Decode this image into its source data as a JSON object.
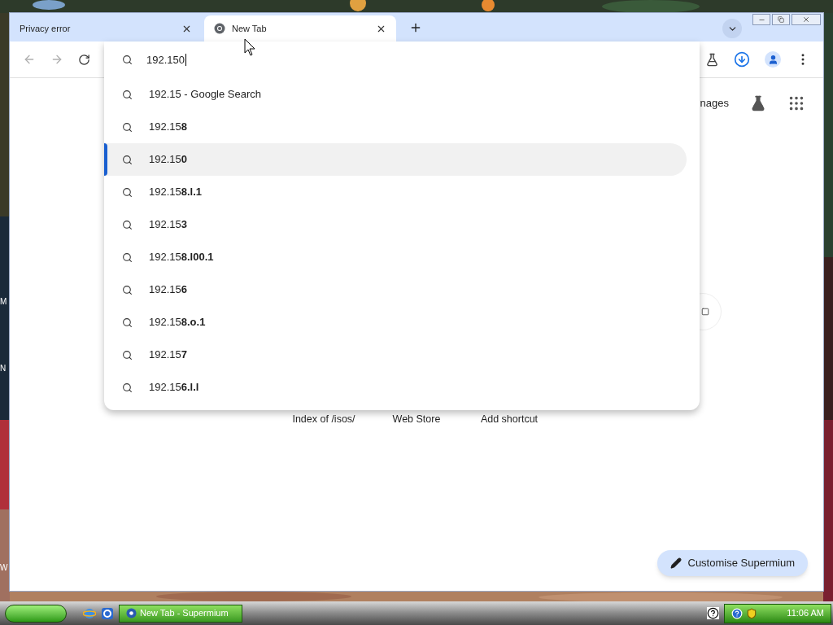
{
  "desktop_labels": [
    "M",
    "N",
    "W"
  ],
  "tabs": [
    {
      "title": "Privacy error",
      "selected": false
    },
    {
      "title": "New Tab",
      "selected": true
    }
  ],
  "omnibox": {
    "value": "192.150"
  },
  "suggestions": [
    {
      "text": "192.15 - Google Search",
      "selected": false
    },
    {
      "text": "192.15**8**",
      "selected": false
    },
    {
      "text": "192.15**0**",
      "selected": true
    },
    {
      "text": "192.15**8.l.1**",
      "selected": false
    },
    {
      "text": "192.15**3**",
      "selected": false
    },
    {
      "text": "192.15**8.l00.1**",
      "selected": false
    },
    {
      "text": "192.15**6**",
      "selected": false
    },
    {
      "text": "192.15**8.o.1**",
      "selected": false
    },
    {
      "text": "192.15**7**",
      "selected": false
    },
    {
      "text": "192.15**6.l.l**",
      "selected": false
    }
  ],
  "page": {
    "header_link": "nages",
    "shortcuts": [
      "Index of /isos/",
      "Web Store",
      "Add shortcut"
    ],
    "customise_button": "Customise Supermium"
  },
  "taskbar": {
    "tasks": [
      "New Tab - Supermium"
    ],
    "clock": "11:06 AM"
  }
}
